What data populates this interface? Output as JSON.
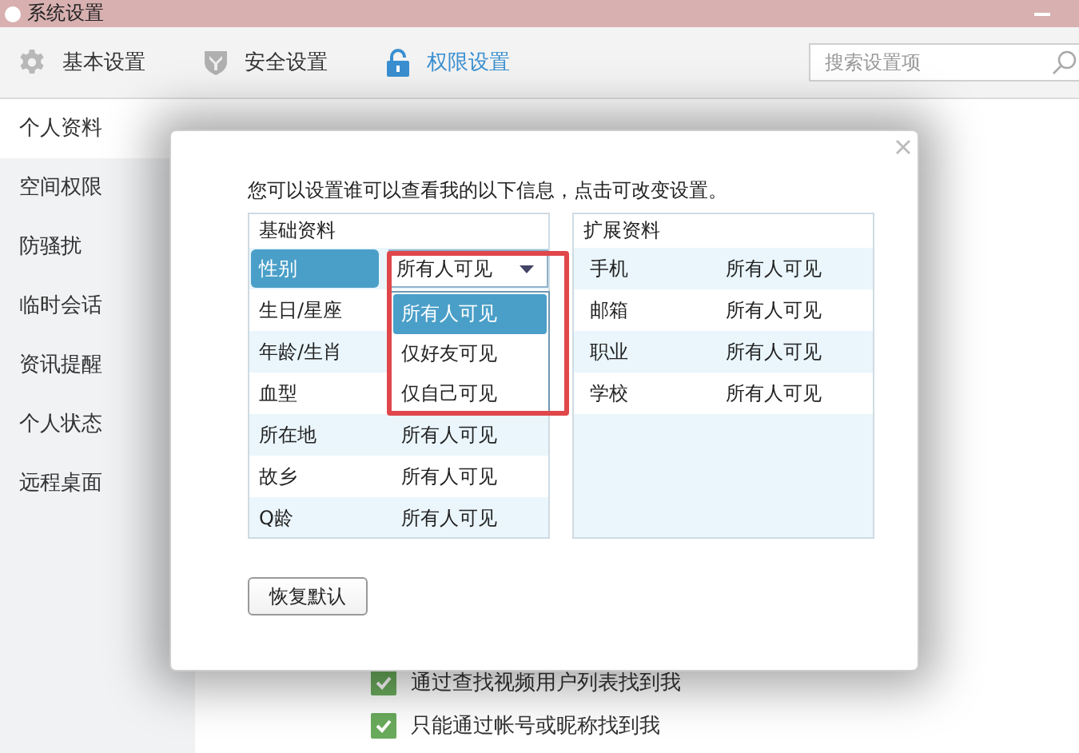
{
  "window": {
    "title": "系统设置"
  },
  "toolbar_tabs": [
    {
      "label": "基本设置",
      "kind": "gear",
      "selected": false
    },
    {
      "label": "安全设置",
      "kind": "shield",
      "selected": false
    },
    {
      "label": "权限设置",
      "kind": "lock",
      "selected": true
    }
  ],
  "search": {
    "placeholder": "搜索设置项"
  },
  "sidebar": {
    "items": [
      {
        "label": "个人资料",
        "selected": true
      },
      {
        "label": "空间权限",
        "selected": false
      },
      {
        "label": "防骚扰",
        "selected": false
      },
      {
        "label": "临时会话",
        "selected": false
      },
      {
        "label": "资讯提醒",
        "selected": false
      },
      {
        "label": "个人状态",
        "selected": false
      },
      {
        "label": "远程桌面",
        "selected": false
      }
    ]
  },
  "options": [
    {
      "label": "通过查找视频用户列表找到我",
      "checked": true
    },
    {
      "label": "只能通过帐号或昵称找到我",
      "checked": true
    }
  ],
  "dialog": {
    "intro": "您可以设置谁可以查看我的以下信息，点击可改变设置。",
    "basic": {
      "heading": "基础资料",
      "rows": [
        {
          "label": "性别",
          "value": "所有人可见",
          "selected": true
        },
        {
          "label": "生日/星座",
          "selected": false
        },
        {
          "label": "年龄/生肖",
          "selected": false
        },
        {
          "label": "血型",
          "selected": false
        },
        {
          "label": "所在地",
          "value": "所有人可见",
          "selected": false
        },
        {
          "label": "故乡",
          "value": "所有人可见",
          "selected": false
        },
        {
          "label": "Q龄",
          "value": "所有人可见",
          "selected": false
        }
      ]
    },
    "extended": {
      "heading": "扩展资料",
      "rows": [
        {
          "label": "手机",
          "value": "所有人可见",
          "selected": false
        },
        {
          "label": "邮箱",
          "value": "所有人可见",
          "selected": false
        },
        {
          "label": "职业",
          "value": "所有人可见",
          "selected": false
        },
        {
          "label": "学校",
          "value": "所有人可见",
          "selected": false
        }
      ]
    },
    "dropdown": {
      "expanded": true,
      "options": [
        {
          "label": "所有人可见",
          "selected": true
        },
        {
          "label": "仅好友可见",
          "selected": false
        },
        {
          "label": "仅自己可见",
          "selected": false
        }
      ]
    },
    "highlight_frame": true,
    "reset_button": "恢复默认"
  }
}
